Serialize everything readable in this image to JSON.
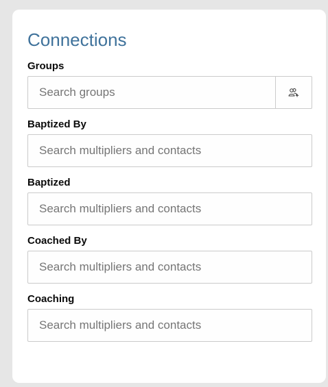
{
  "connections": {
    "title": "Connections",
    "fields": [
      {
        "label": "Groups",
        "placeholder": "Search groups",
        "addon_icon": "add-users-icon"
      },
      {
        "label": "Baptized By",
        "placeholder": "Search multipliers and contacts"
      },
      {
        "label": "Baptized",
        "placeholder": "Search multipliers and contacts"
      },
      {
        "label": "Coached By",
        "placeholder": "Search multipliers and contacts"
      },
      {
        "label": "Coaching",
        "placeholder": "Search multipliers and contacts"
      }
    ]
  },
  "colors": {
    "title": "#3f729b",
    "border": "#cacaca",
    "background": "#e6e6e6",
    "card": "#ffffff"
  }
}
